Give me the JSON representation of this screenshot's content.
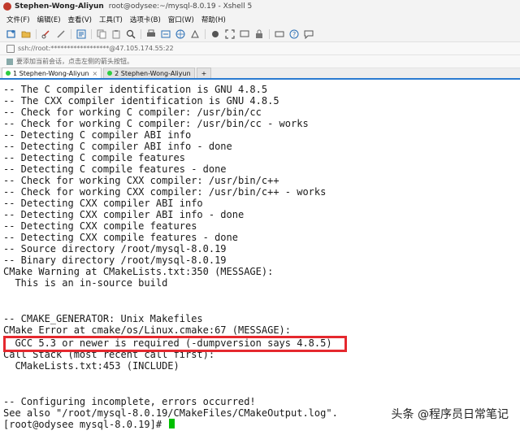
{
  "window": {
    "title": "Stephen-Wong-Aliyun",
    "subtitle": "root@odysee:~/mysql-8.0.19 - Xshell 5"
  },
  "menu": [
    "文件(F)",
    "编辑(E)",
    "查看(V)",
    "工具(T)",
    "选项卡(B)",
    "窗口(W)",
    "帮助(H)"
  ],
  "address": "ssh://root:******************@47.105.174.55:22",
  "hint": "要添加当前会话，点击左侧的箭头按钮。",
  "tabs": [
    {
      "label": "1 Stephen-Wong-Aliyun",
      "color": "#2ecc40",
      "active": true
    },
    {
      "label": "2 Stephen-Wong-Aliyun",
      "color": "#2ecc40",
      "active": false
    }
  ],
  "tab_add": "+",
  "tab_close": "×",
  "terminal_lines": [
    "-- The C compiler identification is GNU 4.8.5",
    "-- The CXX compiler identification is GNU 4.8.5",
    "-- Check for working C compiler: /usr/bin/cc",
    "-- Check for working C compiler: /usr/bin/cc - works",
    "-- Detecting C compiler ABI info",
    "-- Detecting C compiler ABI info - done",
    "-- Detecting C compile features",
    "-- Detecting C compile features - done",
    "-- Check for working CXX compiler: /usr/bin/c++",
    "-- Check for working CXX compiler: /usr/bin/c++ - works",
    "-- Detecting CXX compiler ABI info",
    "-- Detecting CXX compiler ABI info - done",
    "-- Detecting CXX compile features",
    "-- Detecting CXX compile features - done",
    "-- Source directory /root/mysql-8.0.19",
    "-- Binary directory /root/mysql-8.0.19",
    "CMake Warning at CMakeLists.txt:350 (MESSAGE):",
    "  This is an in-source build",
    "",
    "",
    "-- CMAKE_GENERATOR: Unix Makefiles",
    "CMake Error at cmake/os/Linux.cmake:67 (MESSAGE):",
    "  GCC 5.3 or newer is required (-dumpversion says 4.8.5)",
    "Call Stack (most recent call first):",
    "  CMakeLists.txt:453 (INCLUDE)",
    "",
    "",
    "-- Configuring incomplete, errors occurred!",
    "See also \"/root/mysql-8.0.19/CMakeFiles/CMakeOutput.log\".",
    "[root@odysee mysql-8.0.19]# "
  ],
  "watermark": "头条 @程序员日常笔记",
  "colors": {
    "highlight": "#e5282e",
    "cursor": "#00c000",
    "tab_underline": "#2a7bd1"
  }
}
